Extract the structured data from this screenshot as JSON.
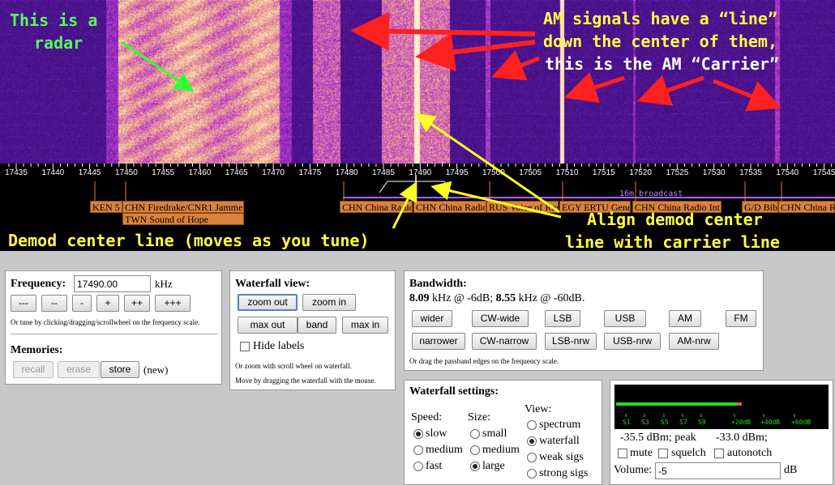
{
  "waterfall": {
    "annotations": {
      "radar_line1": "This is a",
      "radar_line2": "radar",
      "am_line1": "AM signals have a “line”",
      "am_line2": "down the center of them,",
      "am_line3": "this is the AM “Carrier”",
      "align_line1": "Align demod center",
      "align_line2": "line with carrier line",
      "demod_line": "Demod center line (moves as you tune)"
    },
    "colors": {
      "radar_text": "#55ff55",
      "carrier_text": "#ffffff",
      "align_text": "#ffff44",
      "arrow_red": "#ff2020",
      "arrow_yellow": "#ffff22",
      "arrow_green": "#33ff33"
    }
  },
  "scale": {
    "ticks": [
      "17435",
      "17440",
      "17445",
      "17450",
      "17455",
      "17460",
      "17465",
      "17470",
      "17475",
      "17480",
      "17485",
      "17490",
      "17495",
      "17500",
      "17505",
      "17510",
      "17515",
      "17520",
      "17525",
      "17530",
      "17535",
      "17540",
      "17545"
    ],
    "band_label": "16m broadcast",
    "stations": [
      {
        "text": "KEN 5"
      },
      {
        "text": "CHN Firedrake/CNR1 Jammer"
      },
      {
        "text": "TWN Sound of Hope"
      },
      {
        "text": "CHN China Radio"
      },
      {
        "text": "CHN China Radio"
      },
      {
        "text": "RUS Voice of Russia"
      },
      {
        "text": "EGY ERTU General"
      },
      {
        "text": "CHN China Radio Int."
      },
      {
        "text": "G/D Bib"
      },
      {
        "text": "CHN China R"
      }
    ]
  },
  "frequency_panel": {
    "title": "Frequency:",
    "value": "17490.00",
    "unit": "kHz",
    "steps": [
      "---",
      "--",
      "-",
      "+",
      "++",
      "+++"
    ],
    "hint": "Or tune by clicking/dragging/scrollwheel on the frequency scale.",
    "memories_title": "Memories:",
    "recall": "recall",
    "erase": "erase",
    "store": "store",
    "status": "(new)"
  },
  "waterfall_view": {
    "title": "Waterfall view:",
    "zoom_out": "zoom out",
    "zoom_in": "zoom in",
    "max_out": "max out",
    "band": "band",
    "max_in": "max in",
    "hide_labels": "Hide labels",
    "hint1": "Or zoom with scroll wheel on waterfall.",
    "hint2": "Move by dragging the waterfall with the mouse."
  },
  "bandwidth": {
    "title": "Bandwidth:",
    "bw6_value": "8.09",
    "bw6_text": "kHz @ -6dB;",
    "bw60_value": "8.55",
    "bw60_text": "kHz @ -60dB.",
    "row1": [
      "wider",
      "CW-wide",
      "LSB",
      "USB",
      "AM",
      "FM"
    ],
    "row2": [
      "narrower",
      "CW-narrow",
      "LSB-nrw",
      "USB-nrw",
      "AM-nrw"
    ],
    "hint": "Or drag the passband edges on the frequency scale."
  },
  "wf_settings": {
    "title": "Waterfall settings:",
    "speed_label": "Speed:",
    "speed": [
      "slow",
      "medium",
      "fast"
    ],
    "size_label": "Size:",
    "size": [
      "small",
      "medium",
      "large"
    ],
    "view_label": "View:",
    "view": [
      "spectrum",
      "waterfall",
      "weak sigs",
      "strong sigs"
    ]
  },
  "smeter": {
    "scale": [
      "S1",
      "S3",
      "S5",
      "S7",
      "S9",
      "+20dB",
      "+40dB",
      "+60dB"
    ],
    "level_fraction": 0.66,
    "reading": "-35.5 dBm; peak",
    "peak": "-33.0 dBm;",
    "mute": "mute",
    "squelch": "squelch",
    "autonotch": "autonotch",
    "volume_label": "Volume:",
    "volume_value": "-5",
    "volume_unit": "dB",
    "colors": {
      "bar": "#22dd22",
      "peak": "#ff5533",
      "scale_text": "#22dd22"
    }
  }
}
